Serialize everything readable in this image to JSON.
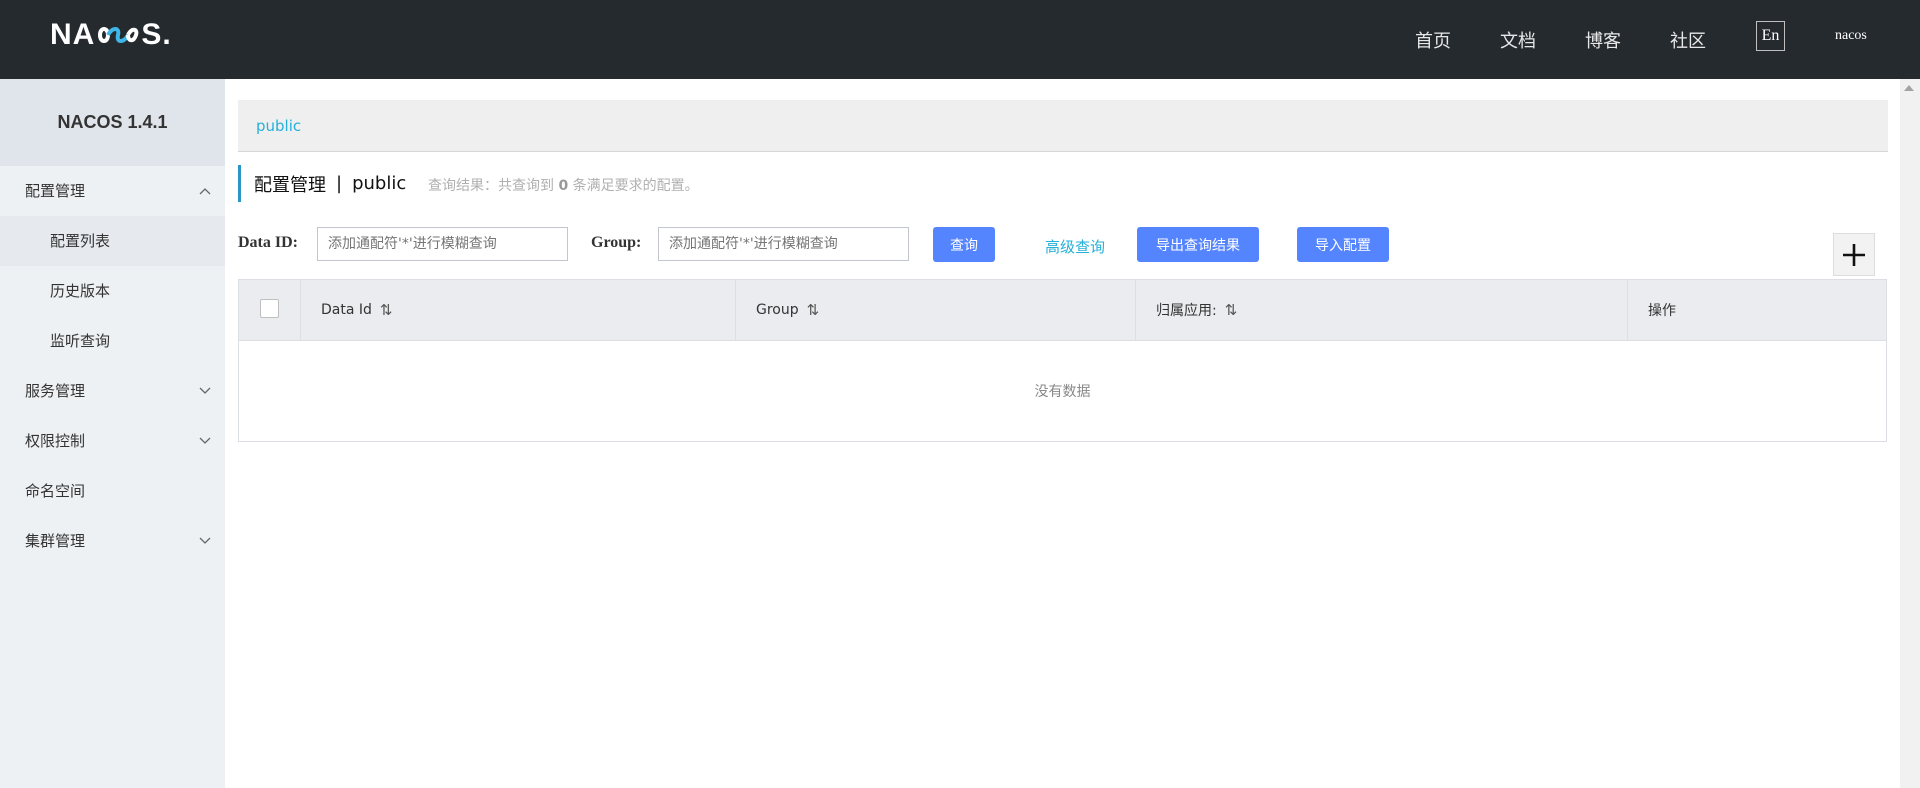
{
  "header": {
    "logo_left": "NA",
    "logo_right": "S",
    "logo_dot": ".",
    "nav": [
      "首页",
      "文档",
      "博客",
      "社区"
    ],
    "lang": "En",
    "user": "nacos"
  },
  "sidebar": {
    "title": "NACOS 1.4.1",
    "menu": [
      {
        "label": "配置管理",
        "expanded": true,
        "children": [
          "配置列表",
          "历史版本",
          "监听查询"
        ]
      },
      {
        "label": "服务管理",
        "expanded": false
      },
      {
        "label": "权限控制",
        "expanded": false
      },
      {
        "label": "命名空间"
      },
      {
        "label": "集群管理",
        "expanded": false
      }
    ]
  },
  "breadcrumb": {
    "namespace": "public"
  },
  "page": {
    "title": "配置管理",
    "separator": "|",
    "namespace": "public",
    "query_result_prefix": "查询结果：共查询到",
    "query_result_count": "0",
    "query_result_suffix": "条满足要求的配置。"
  },
  "filters": {
    "data_id_label": "Data ID:",
    "data_id_placeholder": "添加通配符'*'进行模糊查询",
    "group_label": "Group:",
    "group_placeholder": "添加通配符'*'进行模糊查询",
    "query_button": "查询",
    "advanced_query": "高级查询",
    "export_button": "导出查询结果",
    "import_button": "导入配置"
  },
  "table": {
    "columns": [
      "Data Id",
      "Group",
      "归属应用:",
      "操作"
    ],
    "empty_text": "没有数据"
  },
  "colors": {
    "topbar": "#252a2f",
    "accent": "#5584ff",
    "link": "#26b0d8"
  }
}
